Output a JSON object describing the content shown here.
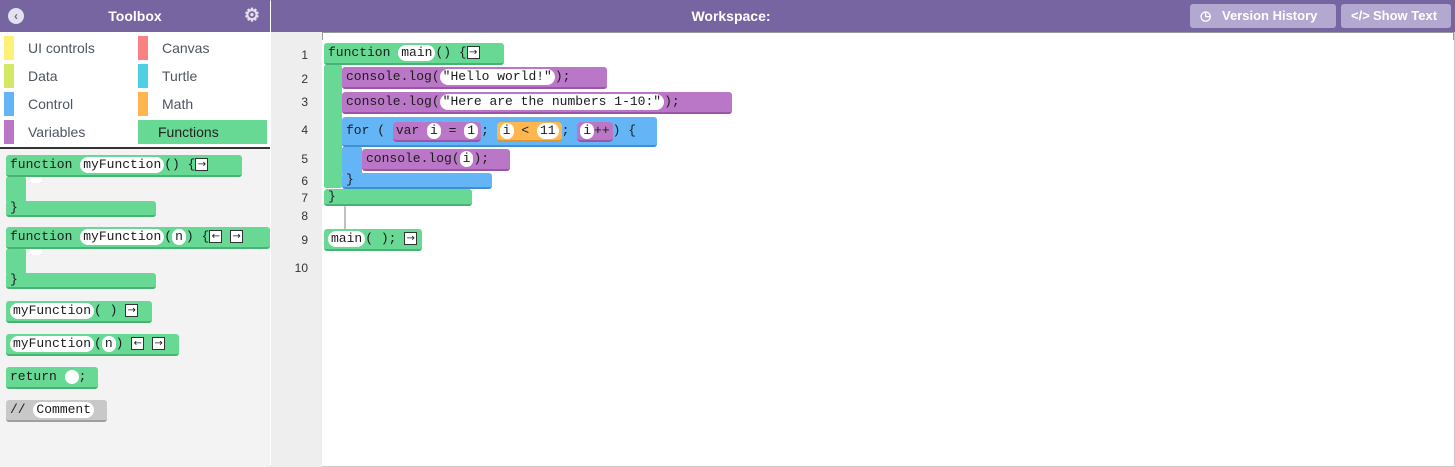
{
  "toolbox": {
    "title": "Toolbox"
  },
  "workspace": {
    "title": "Workspace:"
  },
  "buttons": {
    "version_history": "Version History",
    "show_text": "Show Text"
  },
  "categories": [
    {
      "label": "UI controls",
      "color": "#fff176"
    },
    {
      "label": "Canvas",
      "color": "#f78183"
    },
    {
      "label": "Data",
      "color": "#d3e965"
    },
    {
      "label": "Turtle",
      "color": "#4dd0e1"
    },
    {
      "label": "Control",
      "color": "#64b5f6"
    },
    {
      "label": "Math",
      "color": "#ffb74d"
    },
    {
      "label": "Variables",
      "color": "#bb77c7"
    },
    {
      "label": "Functions",
      "color": "#68d995"
    }
  ],
  "flyout": {
    "kw_function": "function",
    "fname": "myFunction",
    "parens": "()",
    "open_brace": "{",
    "close_brace": "}",
    "param_n": "n",
    "call_close": ")",
    "call_parens": "( )",
    "return_kw": "return",
    "semicolon": ";",
    "comment_prefix": "//",
    "comment_text": "Comment"
  },
  "line_numbers": [
    "1",
    "2",
    "3",
    "4",
    "5",
    "6",
    "7",
    "8",
    "9",
    "10"
  ],
  "code": {
    "fn_kw": "function",
    "fn_name": "main",
    "fn_parens": "()",
    "open_brace": "{",
    "console_log": "console.log",
    "str1": "\"Hello world!\"",
    "str2": "\"Here are the numbers 1-10:\"",
    "close_semi": ");",
    "for_kw": "for (",
    "var_kw": "var",
    "var_i": "i",
    "eq": "=",
    "one": "1",
    "semi": ";",
    "lt": "<",
    "eleven": "11",
    "inc": "++",
    "for_close": ") {",
    "inner_log": "console.log(",
    "inner_close": ");",
    "close_brace": "}",
    "call_main": "main",
    "call_rest": "( );"
  },
  "icons": {
    "collapse": "chevron-left-icon",
    "settings": "gear-icon",
    "history": "clock-icon",
    "code": "code-icon",
    "arrow_right": "→",
    "arrow_left": "←"
  }
}
